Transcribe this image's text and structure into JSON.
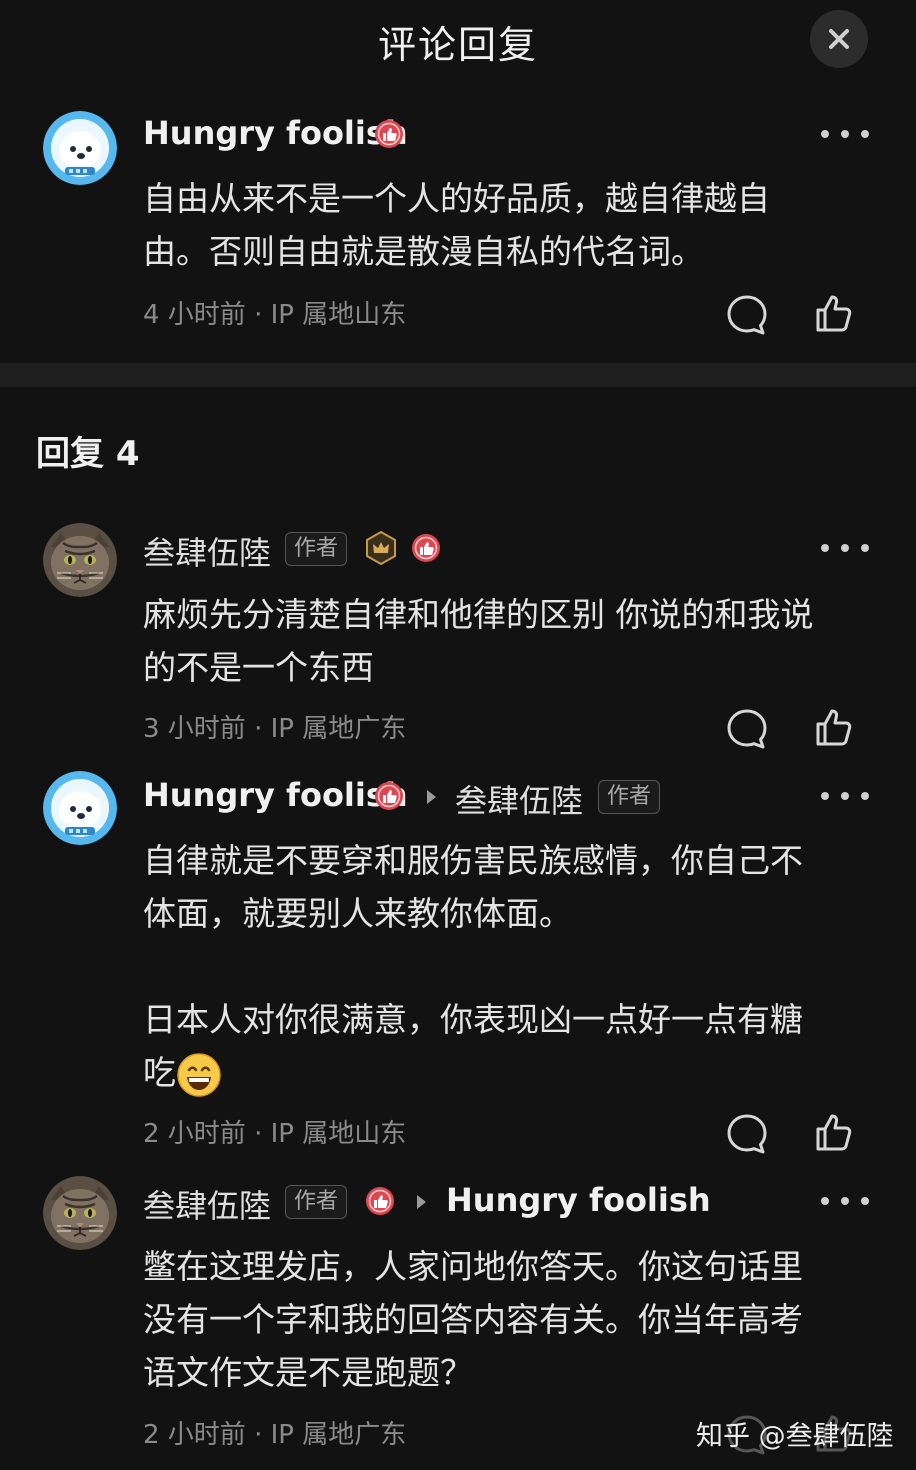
{
  "header": {
    "title": "评论回复"
  },
  "icons": {
    "close": "close-icon",
    "reply": "comment-bubble-icon",
    "like": "thumbs-up-icon",
    "more": "more-dots-icon"
  },
  "colors": {
    "background": "#121212",
    "like_badge": "#e0464f",
    "crown_badge": "#b8923f"
  },
  "main_comment": {
    "user": "Hungry foolish",
    "text_lines": [
      "自由从来不是一个人的好品质，越自律越自",
      "由。否则自由就是散漫自私的代名词。"
    ],
    "meta": "4 小时前 · IP 属地山东"
  },
  "replies_header": "回复 4",
  "replies": [
    {
      "user": "叁肆伍陸",
      "author_tag": "作者",
      "text_lines": [
        "麻烦先分清楚自律和他律的区别 你说的和我说",
        "的不是一个东西"
      ],
      "meta": "3 小时前 · IP 属地广东"
    },
    {
      "user": "Hungry foolish",
      "reply_to": "叁肆伍陸",
      "reply_to_tag": "作者",
      "text_lines": [
        "自律就是不要穿和服伤害民族感情，你自己不",
        "体面，就要别人来教你体面。",
        "",
        "日本人对你很满意，你表现凶一点好一点有糖",
        "吃"
      ],
      "meta": "2 小时前 · IP 属地山东"
    },
    {
      "user": "叁肆伍陸",
      "author_tag": "作者",
      "reply_to": "Hungry foolish",
      "text_lines": [
        "鳖在这理发店，人家问地你答天。你这句话里",
        "没有一个字和我的回答内容有关。你当年高考",
        "语文作文是不是跑题？"
      ],
      "meta": "2 小时前 · IP 属地广东"
    }
  ],
  "watermark": "知乎 @叁肆伍陸"
}
